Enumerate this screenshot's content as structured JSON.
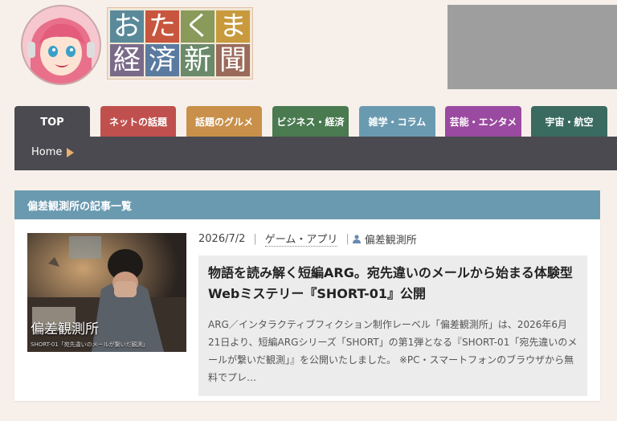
{
  "header": {
    "logo_chars": [
      "お",
      "た",
      "く",
      "ま",
      "経",
      "済",
      "新",
      "聞"
    ],
    "logo_colors": [
      "#5a8a9a",
      "#c8553d",
      "#8a9a5a",
      "#c89a3d",
      "#7a6a8a",
      "#5a7aa0",
      "#6a8a6a",
      "#9a6a5a"
    ]
  },
  "nav": {
    "tabs": [
      {
        "label": "TOP",
        "color": "#4a4a50"
      },
      {
        "label": "ネットの話題",
        "color": "#c0504d"
      },
      {
        "label": "話題のグルメ",
        "color": "#c8904a"
      },
      {
        "label": "ビジネス・経済",
        "color": "#4a7a50"
      },
      {
        "label": "雑学・コラム",
        "color": "#6a9ab0"
      },
      {
        "label": "芸能・エンタメ",
        "color": "#9a4aa0"
      },
      {
        "label": "宇宙・航空",
        "color": "#3a6a60"
      }
    ],
    "breadcrumb": "Home"
  },
  "section": {
    "title": "偏差観測所の記事一覧"
  },
  "article": {
    "date": "2026/7/2",
    "category": "ゲーム・アプリ",
    "author": "偏差観測所",
    "thumb_title": "偏差観測所",
    "thumb_sub": "SHORT-01「宛先違いのメールが繋いだ観測」",
    "headline": "物語を読み解く短編ARG。宛先違いのメールから始まる体験型Webミステリー『SHORT-01』公開",
    "excerpt": "ARG／インタラクティブフィクション制作レーベル「偏差観測所」は、2026年6月21日より、短編ARGシリーズ「SHORT」の第1弾となる『SHORT-01「宛先違いのメールが繋いだ観測」』を公開いたしました。 ※PC・スマートフォンのブラウザから無料でプレ…"
  }
}
